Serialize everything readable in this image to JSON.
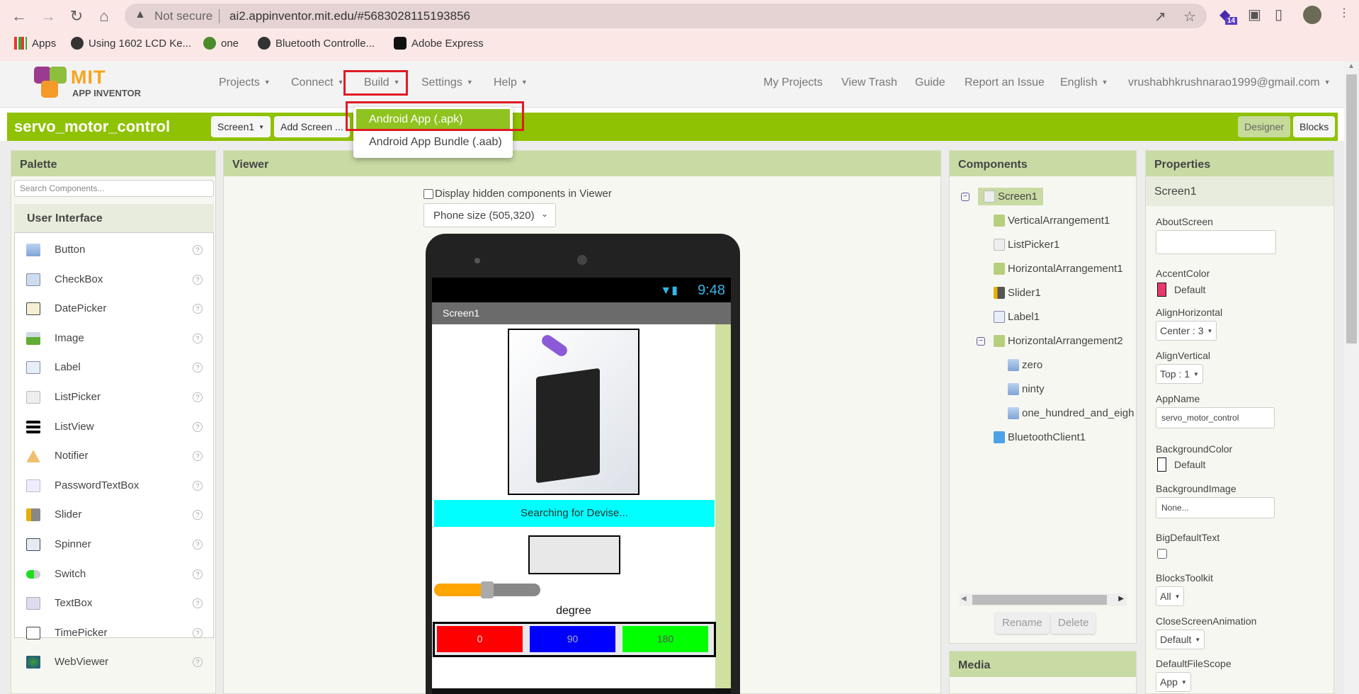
{
  "browser": {
    "security_label": "Not secure",
    "url": "ai2.appinventor.mit.edu/#5683028115193856",
    "extension_badge": "14",
    "bookmarks": [
      {
        "label": "Apps"
      },
      {
        "label": "Using 1602 LCD Ke..."
      },
      {
        "label": "one"
      },
      {
        "label": "Bluetooth Controlle..."
      },
      {
        "label": "Adobe Express"
      }
    ]
  },
  "header": {
    "logo_title": "MIT",
    "logo_subtitle": "APP INVENTOR",
    "menus": [
      "Projects",
      "Connect",
      "Build",
      "Settings",
      "Help"
    ],
    "right_links": [
      "My Projects",
      "View Trash",
      "Guide",
      "Report an Issue",
      "English",
      "vrushabhkrushnarao1999@gmail.com"
    ]
  },
  "build_menu": {
    "items": [
      "Android App (.apk)",
      "Android App Bundle (.aab)"
    ],
    "highlighted": "Android App (.apk)"
  },
  "project_bar": {
    "project_name": "servo_motor_control",
    "screen_select": "Screen1",
    "add_screen": "Add Screen ...",
    "designer": "Designer",
    "blocks": "Blocks"
  },
  "palette": {
    "title": "Palette",
    "search_placeholder": "Search Components...",
    "category": "User Interface",
    "items": [
      "Button",
      "CheckBox",
      "DatePicker",
      "Image",
      "Label",
      "ListPicker",
      "ListView",
      "Notifier",
      "PasswordTextBox",
      "Slider",
      "Spinner",
      "Switch",
      "TextBox",
      "TimePicker",
      "WebViewer"
    ]
  },
  "viewer": {
    "title": "Viewer",
    "hidden_checkbox_label": "Display hidden components in Viewer",
    "hidden_checked": false,
    "size_select": "Phone size (505,320)",
    "phone": {
      "time": "9:48",
      "screen_title": "Screen1",
      "listpicker_text": "Searching for Devise...",
      "listpicker_color": "#00ffff",
      "slider_fraction": 0.5,
      "label_text": "degree",
      "buttons": [
        {
          "label": "0",
          "color": "#ff0000"
        },
        {
          "label": "90",
          "color": "#0000ff"
        },
        {
          "label": "180",
          "color": "#00ff00"
        }
      ]
    }
  },
  "components": {
    "title": "Components",
    "tree": [
      {
        "name": "Screen1",
        "level": 0,
        "selected": true
      },
      {
        "name": "VerticalArrangement1",
        "level": 1
      },
      {
        "name": "ListPicker1",
        "level": 1
      },
      {
        "name": "HorizontalArrangement1",
        "level": 1
      },
      {
        "name": "Slider1",
        "level": 1
      },
      {
        "name": "Label1",
        "level": 1
      },
      {
        "name": "HorizontalArrangement2",
        "level": 1
      },
      {
        "name": "zero",
        "level": 2
      },
      {
        "name": "ninty",
        "level": 2
      },
      {
        "name": "one_hundred_and_eigh",
        "level": 2
      },
      {
        "name": "BluetoothClient1",
        "level": 1
      }
    ],
    "rename": "Rename",
    "delete": "Delete",
    "media_title": "Media"
  },
  "properties": {
    "title": "Properties",
    "component": "Screen1",
    "about_screen_label": "AboutScreen",
    "about_screen_value": "",
    "accent_color_label": "AccentColor",
    "accent_color_value": "Default",
    "accent_color_hex": "#e9386a",
    "align_h_label": "AlignHorizontal",
    "align_h_value": "Center : 3",
    "align_v_label": "AlignVertical",
    "align_v_value": "Top : 1",
    "app_name_label": "AppName",
    "app_name_value": "servo_motor_control",
    "bg_color_label": "BackgroundColor",
    "bg_color_value": "Default",
    "bg_image_label": "BackgroundImage",
    "bg_image_value": "None...",
    "big_text_label": "BigDefaultText",
    "big_text_checked": false,
    "toolkit_label": "BlocksToolkit",
    "toolkit_value": "All",
    "close_anim_label": "CloseScreenAnimation",
    "close_anim_value": "Default",
    "file_scope_label": "DefaultFileScope",
    "file_scope_value": "App"
  }
}
